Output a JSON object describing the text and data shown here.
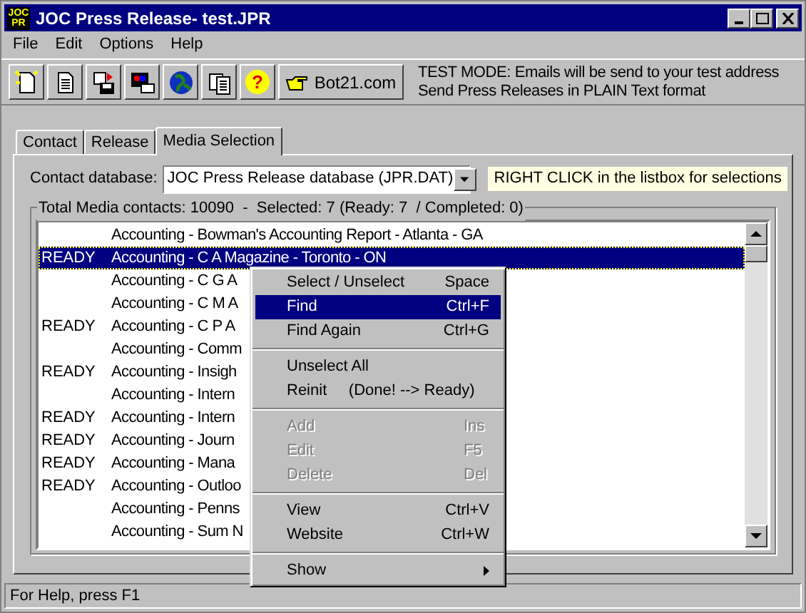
{
  "window": {
    "title": "JOC Press Release- test.JPR",
    "logo": [
      "JOC",
      "PR"
    ]
  },
  "menu_bar": [
    "File",
    "Edit",
    "Options",
    "Help"
  ],
  "toolbar": {
    "help_glyph": "?",
    "link_button": "Bot21.com",
    "notice": [
      "TEST MODE: Emails will be send to your test address",
      "Send Press Releases in PLAIN Text format"
    ]
  },
  "tabs": [
    {
      "label": "Contact",
      "selected": false
    },
    {
      "label": "Release",
      "selected": false
    },
    {
      "label": "Media Selection",
      "selected": true
    }
  ],
  "contact_database": {
    "label": "Contact database:",
    "value": "JOC Press Release database (JPR.DAT)",
    "hint": "RIGHT CLICK in the listbox for selections"
  },
  "media_group": {
    "title": "Total Media contacts: 10090  -  Selected: 7 (Ready: 7  / Completed: 0)",
    "rows": [
      {
        "status": "",
        "name": "Accounting - Bowman's Accounting Report - Atlanta - GA",
        "selected": false
      },
      {
        "status": "READY",
        "name": "Accounting - C A Magazine - Toronto - ON",
        "selected": true
      },
      {
        "status": "",
        "name": "Accounting - C G A",
        "selected": false
      },
      {
        "status": "",
        "name": "Accounting - C M A",
        "selected": false
      },
      {
        "status": "READY",
        "name": "Accounting - C P A",
        "selected": false
      },
      {
        "status": "",
        "name": "Accounting - Comm",
        "selected": false
      },
      {
        "status": "READY",
        "name": "Accounting - Insigh",
        "selected": false
      },
      {
        "status": "",
        "name": "Accounting - Intern",
        "selected": false
      },
      {
        "status": "READY",
        "name": "Accounting - Intern",
        "selected": false
      },
      {
        "status": "READY",
        "name": "Accounting - Journ",
        "selected": false
      },
      {
        "status": "READY",
        "name": "Accounting - Mana",
        "selected": false
      },
      {
        "status": "READY",
        "name": "Accounting - Outloo",
        "selected": false
      },
      {
        "status": "",
        "name": "Accounting - Penns",
        "selected": false
      },
      {
        "status": "",
        "name": "Accounting - Sum N",
        "selected": false
      }
    ]
  },
  "context_menu": [
    [
      {
        "label": "Select / Unselect",
        "shortcut": "Space",
        "selected": false,
        "disabled": false,
        "kind": "item"
      },
      {
        "label": "Find",
        "shortcut": "Ctrl+F",
        "selected": true,
        "disabled": false,
        "kind": "item"
      },
      {
        "label": "Find Again",
        "shortcut": "Ctrl+G",
        "selected": false,
        "disabled": false,
        "kind": "item"
      }
    ],
    [
      {
        "label": "Unselect All",
        "selected": false,
        "disabled": false,
        "kind": "item"
      },
      {
        "label": "Reinit     (Done! --> Ready)",
        "selected": false,
        "disabled": false,
        "kind": "item"
      }
    ],
    [
      {
        "label": "Add",
        "shortcut": "Ins",
        "selected": false,
        "disabled": true,
        "kind": "item"
      },
      {
        "label": "Edit",
        "shortcut": "F5",
        "selected": false,
        "disabled": true,
        "kind": "item"
      },
      {
        "label": "Delete",
        "shortcut": "Del",
        "selected": false,
        "disabled": true,
        "kind": "item"
      }
    ],
    [
      {
        "label": "View",
        "shortcut": "Ctrl+V",
        "selected": false,
        "disabled": false,
        "kind": "item"
      },
      {
        "label": "Website",
        "shortcut": "Ctrl+W",
        "selected": false,
        "disabled": false,
        "kind": "item"
      }
    ],
    [
      {
        "label": "Show",
        "selected": false,
        "disabled": false,
        "kind": "submenu"
      }
    ]
  ],
  "status_bar": "For Help, press F1"
}
